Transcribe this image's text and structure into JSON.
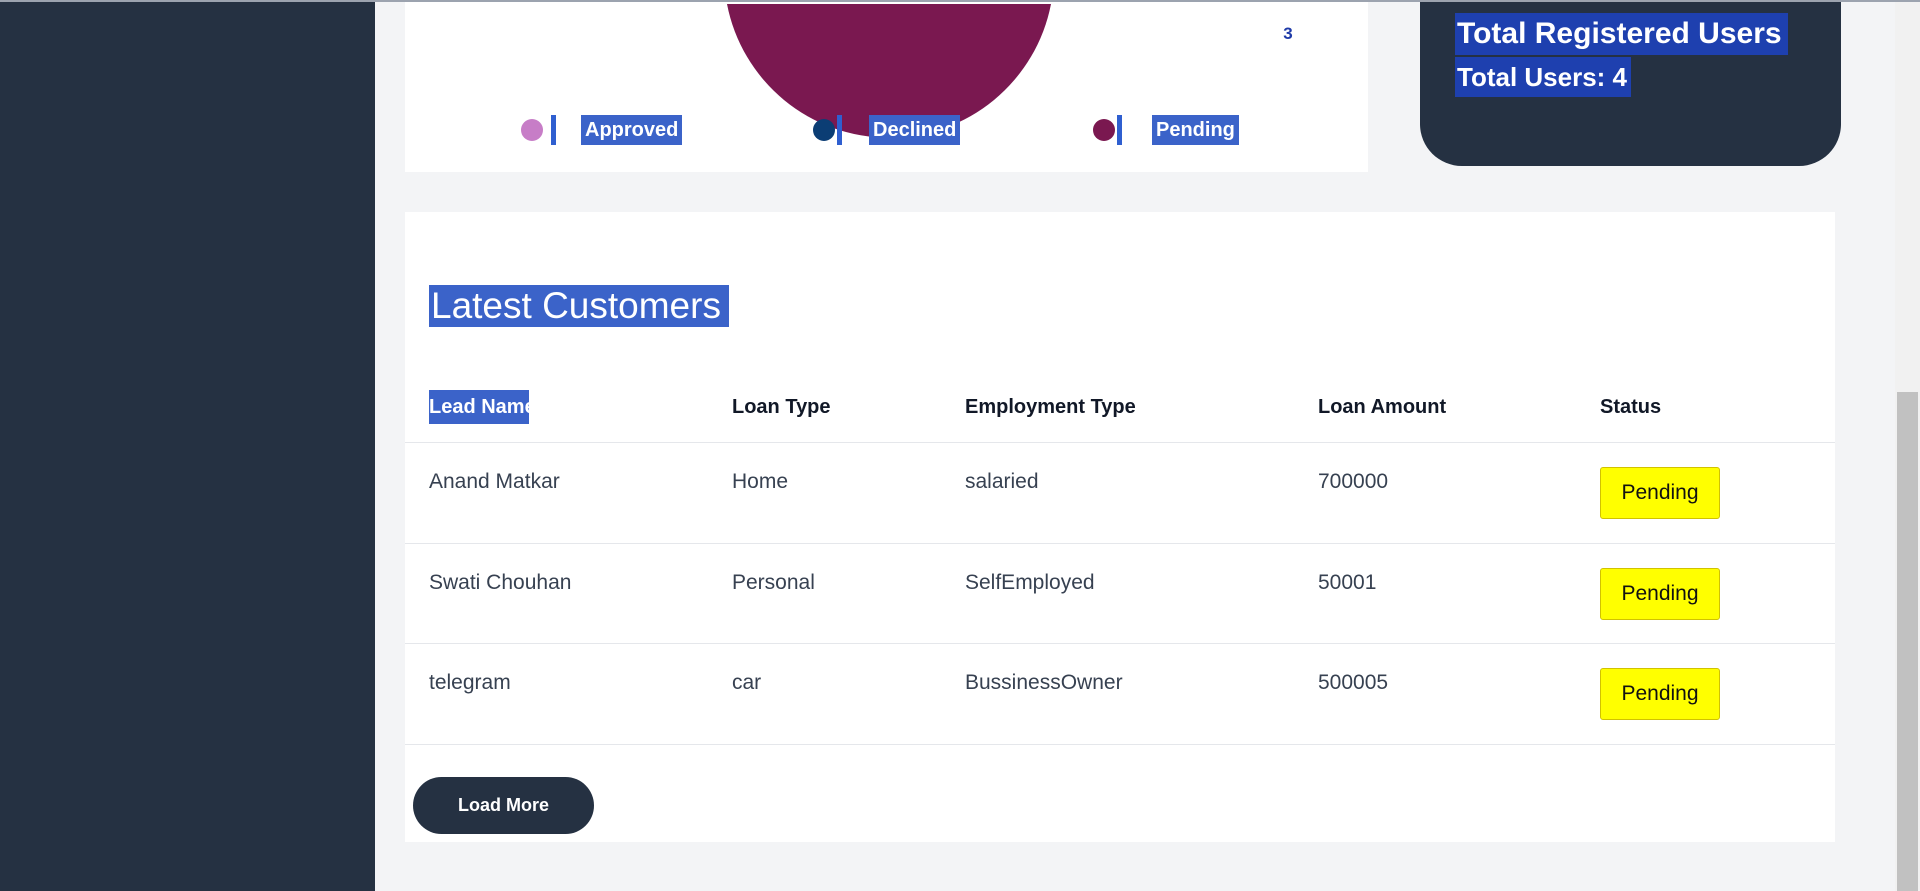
{
  "pie_chart": {
    "slice_label": "3",
    "legend": [
      {
        "label": "Approved",
        "color": "#c77dc7"
      },
      {
        "label": "Declined",
        "color": "#0b3d74"
      },
      {
        "label": "Pending",
        "color": "#7a1850"
      }
    ]
  },
  "users_card": {
    "title": "Total Registered Users",
    "count_text": "Total Users: 4"
  },
  "customers": {
    "title": "Latest Customers",
    "columns": [
      "Lead Name",
      "Loan Type",
      "Employment Type",
      "Loan Amount",
      "Status"
    ],
    "rows": [
      {
        "lead_name": "Anand Matkar",
        "loan_type": "Home",
        "employment_type": "salaried",
        "loan_amount": "700000",
        "status": "Pending"
      },
      {
        "lead_name": "Swati Chouhan",
        "loan_type": "Personal",
        "employment_type": "SelfEmployed",
        "loan_amount": "50001",
        "status": "Pending"
      },
      {
        "lead_name": "telegram",
        "loan_type": "car",
        "employment_type": "BussinessOwner",
        "loan_amount": "500005",
        "status": "Pending"
      }
    ],
    "load_more_label": "Load More"
  },
  "colors": {
    "sidebar": "#253142",
    "status_pending": "#ffff00",
    "selection": "#3b63c9"
  }
}
